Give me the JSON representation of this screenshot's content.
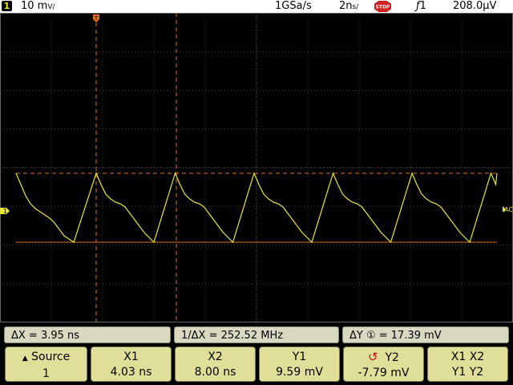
{
  "header": {
    "channel_number": "1",
    "scale": "10 m",
    "scale_unit": "V/",
    "sample_rate": "1GSa/s",
    "timebase": "2n",
    "timebase_unit": "s/",
    "run_state": "STOP",
    "trigger_channel": "1",
    "trigger_level": "208.0µV"
  },
  "markers": {
    "ground": "1",
    "right_edge": "AC"
  },
  "measurements": {
    "delta_x": "ΔX =  3.95 ns",
    "inv_delta_x": "1/ΔX = 252.52 MHz",
    "delta_y": "ΔY ① = 17.39 mV"
  },
  "softkeys": [
    {
      "line1": "Source",
      "line2": "1"
    },
    {
      "line1": "X1",
      "line2": "4.03 ns"
    },
    {
      "line1": "X2",
      "line2": "8.00 ns"
    },
    {
      "line1": "Y1",
      "line2": "9.59 mV"
    },
    {
      "line1": "Y2",
      "line2": "-7.79 mV"
    },
    {
      "line1": "X1  X2",
      "line2": "Y1  Y2"
    }
  ],
  "colors": {
    "trace": "#e8e83a",
    "cursor": "#e07020",
    "grid": "#3a3a3a"
  }
}
